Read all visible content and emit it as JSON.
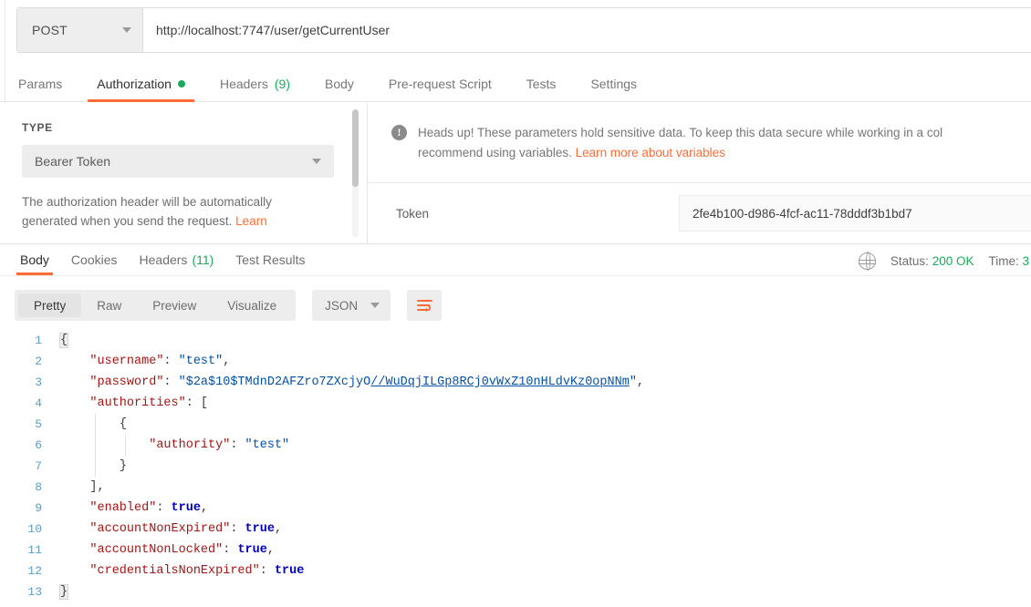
{
  "request_bar": {
    "method": "POST",
    "method_caret_icon": "chevron-down-icon",
    "url": "http://localhost:7747/user/getCurrentUser",
    "url_placeholder": "Enter request URL"
  },
  "request_tabs": [
    {
      "label": "Params",
      "active": false,
      "badge": "",
      "dot": false
    },
    {
      "label": "Authorization",
      "active": true,
      "badge": "",
      "dot": true
    },
    {
      "label": "Headers",
      "active": false,
      "badge": "(9)",
      "dot": false
    },
    {
      "label": "Body",
      "active": false,
      "badge": "",
      "dot": false
    },
    {
      "label": "Pre-request Script",
      "active": false,
      "badge": "",
      "dot": false
    },
    {
      "label": "Tests",
      "active": false,
      "badge": "",
      "dot": false
    },
    {
      "label": "Settings",
      "active": false,
      "badge": "",
      "dot": false
    }
  ],
  "authorization": {
    "type_label": "TYPE",
    "type_value": "Bearer Token",
    "type_caret_icon": "chevron-down-icon",
    "help_text": "The authorization header will be automatically generated when you send the request. ",
    "help_link": "Learn",
    "warning": {
      "icon": "alert-circle-icon",
      "line1": "Heads up! These parameters hold sensitive data. To keep this data secure while working in a col",
      "line2_prefix": "recommend using variables. ",
      "line2_link": "Learn more about variables"
    },
    "token_label": "Token",
    "token_value": "2fe4b100-d986-4fcf-ac11-78dddf3b1bd7",
    "token_placeholder": "Token"
  },
  "response_tabs": [
    {
      "label": "Body",
      "active": true,
      "badge": ""
    },
    {
      "label": "Cookies",
      "active": false,
      "badge": ""
    },
    {
      "label": "Headers",
      "active": false,
      "badge": "(11)"
    },
    {
      "label": "Test Results",
      "active": false,
      "badge": ""
    }
  ],
  "response_status": {
    "globe_icon": "globe-icon",
    "status_label": "Status:",
    "status_value": "200 OK",
    "time_label": "Time:",
    "time_value": "3"
  },
  "format_bar": {
    "views": [
      {
        "label": "Pretty",
        "active": true
      },
      {
        "label": "Raw",
        "active": false
      },
      {
        "label": "Preview",
        "active": false
      },
      {
        "label": "Visualize",
        "active": false
      }
    ],
    "language": "JSON",
    "language_caret_icon": "chevron-down-icon",
    "wrap_icon": "wrap-text-icon"
  },
  "response_body": {
    "language": "json",
    "lines": [
      {
        "n": "1",
        "indent": 0,
        "html": "<span class=\"p brace-hl\">{</span>"
      },
      {
        "n": "2",
        "indent": 1,
        "html": "    <span class=\"k\">\"username\"</span><span class=\"p\">: </span><span class=\"s\">\"test\"</span><span class=\"p\">,</span>"
      },
      {
        "n": "3",
        "indent": 1,
        "html": "    <span class=\"k\">\"password\"</span><span class=\"p\">: </span><span class=\"s\">\"$2a$10$TMdnD2AFZro7ZXcjyO</span><span class=\"u\">//WuDqjILGp8RCj0vWxZ10nHLdvKz0opNNm</span><span class=\"s\">\"</span><span class=\"p\">,</span>"
      },
      {
        "n": "4",
        "indent": 1,
        "html": "    <span class=\"k\">\"authorities\"</span><span class=\"p\">: [</span>"
      },
      {
        "n": "5",
        "indent": 2,
        "html": "        <span class=\"p\">{</span>"
      },
      {
        "n": "6",
        "indent": 3,
        "html": "            <span class=\"k\">\"authority\"</span><span class=\"p\">: </span><span class=\"s\">\"test\"</span>"
      },
      {
        "n": "7",
        "indent": 2,
        "html": "        <span class=\"p\">}</span>"
      },
      {
        "n": "8",
        "indent": 1,
        "html": "    <span class=\"p\">],</span>"
      },
      {
        "n": "9",
        "indent": 1,
        "html": "    <span class=\"k\">\"enabled\"</span><span class=\"p\">: </span><span class=\"b\">true</span><span class=\"p\">,</span>"
      },
      {
        "n": "10",
        "indent": 1,
        "html": "    <span class=\"k\">\"accountNonExpired\"</span><span class=\"p\">: </span><span class=\"b\">true</span><span class=\"p\">,</span>"
      },
      {
        "n": "11",
        "indent": 1,
        "html": "    <span class=\"k\">\"accountNonLocked\"</span><span class=\"p\">: </span><span class=\"b\">true</span><span class=\"p\">,</span>"
      },
      {
        "n": "12",
        "indent": 1,
        "html": "    <span class=\"k\">\"credentialsNonExpired\"</span><span class=\"p\">: </span><span class=\"b\">true</span>"
      },
      {
        "n": "13",
        "indent": 0,
        "html": "<span class=\"p brace-hl\">}</span>"
      }
    ],
    "plain": {
      "username": "test",
      "password": "$2a$10$TMdnD2AFZro7ZXcjyO//WuDqjILGp8RCj0vWxZ10nHLdvKz0opNNm",
      "authorities": [
        {
          "authority": "test"
        }
      ],
      "enabled": "true",
      "accountNonExpired": "true",
      "accountNonLocked": "true",
      "credentialsNonExpired": "true"
    }
  },
  "colors": {
    "accent": "#ff6c37",
    "success": "#1bab5c",
    "panel_bg": "#ededed",
    "border": "#e6e6e6",
    "json_key": "#a31515",
    "json_string": "#0451a5",
    "json_bool": "#0000c0",
    "line_number": "#5b9ec4"
  }
}
